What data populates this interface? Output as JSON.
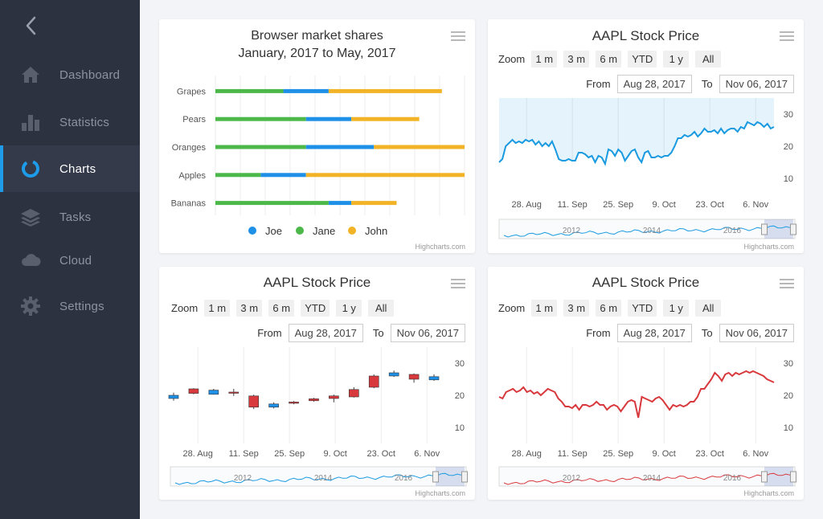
{
  "sidebar": {
    "items": [
      {
        "label": "Dashboard",
        "icon": "home-icon"
      },
      {
        "label": "Statistics",
        "icon": "bar-chart-icon"
      },
      {
        "label": "Charts",
        "icon": "donut-icon",
        "active": true
      },
      {
        "label": "Tasks",
        "icon": "layers-icon"
      },
      {
        "label": "Cloud",
        "icon": "cloud-icon"
      },
      {
        "label": "Settings",
        "icon": "gear-icon"
      }
    ]
  },
  "colors": {
    "sidebar_bg": "#2d3240",
    "active_accent": "#1e9be9",
    "joe": "#1e90e8",
    "jane": "#4cb84a",
    "john": "#f2b426",
    "line_blue": "#1a9ae0",
    "line_red": "#d8393d",
    "candle_up": "#1e90e8",
    "candle_down": "#d8393d"
  },
  "credit": "Highcharts.com",
  "browser_card": {
    "title_line1": "Browser market shares",
    "title_line2": "January, 2017 to May, 2017",
    "chart_data": {
      "type": "bar",
      "stacked": true,
      "orientation": "horizontal",
      "categories": [
        "Grapes",
        "Pears",
        "Oranges",
        "Apples",
        "Bananas"
      ],
      "series": [
        {
          "name": "Jane",
          "values": [
            3,
            4,
            4,
            2,
            5
          ]
        },
        {
          "name": "Joe",
          "values": [
            2,
            2,
            3,
            2,
            1
          ]
        },
        {
          "name": "John",
          "values": [
            5,
            3,
            4,
            7,
            2
          ]
        }
      ],
      "legend": [
        "Joe",
        "Jane",
        "John"
      ],
      "legend_placement": "bottom",
      "xlim": [
        0,
        11
      ]
    }
  },
  "stock_common": {
    "title": "AAPL Stock Price",
    "zoom_label": "Zoom",
    "zoom_buttons": [
      "1 m",
      "3 m",
      "6 m",
      "YTD",
      "1 y",
      "All"
    ],
    "from_label": "From",
    "to_label": "To",
    "from_date": "Aug 28, 2017",
    "to_date": "Nov 06, 2017",
    "x_ticks": [
      "28. Aug",
      "11. Sep",
      "25. Sep",
      "9. Oct",
      "23. Oct",
      "6. Nov"
    ],
    "y_ticks": [
      "30",
      "20",
      "10"
    ],
    "navigator_labels": [
      "2012",
      "2014",
      "2016"
    ]
  },
  "chart_area": {
    "chart_data": {
      "type": "area",
      "ylim": [
        5,
        35
      ],
      "values": [
        15,
        16,
        20,
        21,
        22,
        21,
        21.5,
        21,
        22,
        21.5,
        22,
        20.5,
        21.5,
        20,
        21,
        20,
        21.5,
        19,
        16,
        15.5,
        15.5,
        16,
        15.5,
        15.5,
        18,
        18,
        17.5,
        16.5,
        17,
        15,
        17,
        16.5,
        14.5,
        19,
        18.5,
        17,
        19,
        18,
        15.5,
        17,
        18.5,
        19,
        16.5,
        15,
        18,
        18.5,
        16.5,
        16.5,
        17,
        16.5,
        17,
        17,
        18,
        20,
        22.5,
        22.5,
        23.5,
        23,
        23.5,
        24.5,
        23,
        24,
        25.5,
        24.5,
        24.5,
        25,
        24,
        25.5,
        24,
        25,
        25.5,
        25.5,
        24.5,
        26,
        25.5,
        27.5,
        27,
        26.5,
        27.5,
        27,
        26,
        27,
        25.5,
        26
      ]
    }
  },
  "chart_candle": {
    "chart_data": {
      "type": "candlestick",
      "ylim": [
        5,
        35
      ],
      "candles": [
        {
          "o": 20.0,
          "h": 20.8,
          "l": 18.3,
          "c": 19.0
        },
        {
          "o": 20.6,
          "h": 22.2,
          "l": 20.3,
          "c": 22.0
        },
        {
          "o": 21.6,
          "h": 22.0,
          "l": 20.2,
          "c": 20.3
        },
        {
          "o": 21.0,
          "h": 22.0,
          "l": 19.8,
          "c": 21.0
        },
        {
          "o": 16.3,
          "h": 20.2,
          "l": 15.7,
          "c": 19.8
        },
        {
          "o": 17.3,
          "h": 17.8,
          "l": 15.9,
          "c": 16.3
        },
        {
          "o": 17.5,
          "h": 18.2,
          "l": 17.2,
          "c": 17.9
        },
        {
          "o": 18.3,
          "h": 19.2,
          "l": 18.0,
          "c": 18.9
        },
        {
          "o": 19.0,
          "h": 20.2,
          "l": 17.8,
          "c": 19.8
        },
        {
          "o": 19.5,
          "h": 22.5,
          "l": 19.3,
          "c": 21.8
        },
        {
          "o": 22.5,
          "h": 26.5,
          "l": 22.2,
          "c": 26.0
        },
        {
          "o": 27.0,
          "h": 27.7,
          "l": 25.7,
          "c": 26.0
        },
        {
          "o": 25.0,
          "h": 26.8,
          "l": 23.9,
          "c": 26.5
        },
        {
          "o": 25.8,
          "h": 26.5,
          "l": 24.5,
          "c": 24.8
        }
      ]
    }
  },
  "chart_line": {
    "chart_data": {
      "type": "line",
      "ylim": [
        5,
        35
      ],
      "values": [
        19.5,
        19,
        21,
        21.5,
        22,
        21,
        21.5,
        22.5,
        21,
        21.5,
        20.5,
        21,
        20,
        21,
        22,
        21.5,
        21,
        19,
        18,
        16.5,
        16.5,
        16,
        17,
        15.5,
        17,
        17,
        16.5,
        17,
        18,
        17,
        17,
        15.5,
        16.5,
        17,
        16.5,
        15,
        16.5,
        18,
        18.5,
        18,
        13,
        19.5,
        19,
        18.5,
        18,
        19,
        19.5,
        18.5,
        17,
        15.5,
        17,
        16.5,
        17,
        16.5,
        17,
        18,
        18,
        19.5,
        22,
        22,
        23.5,
        25,
        27,
        26,
        24.5,
        26.5,
        27,
        26,
        27,
        26.5,
        27,
        27.5,
        27,
        27.5,
        27,
        26.5,
        26,
        25,
        24.5,
        24
      ]
    }
  }
}
